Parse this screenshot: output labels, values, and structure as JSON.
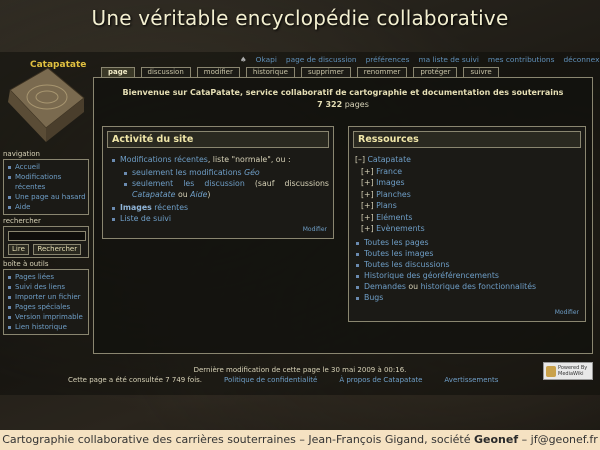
{
  "slide_title": "Une véritable encyclopédie collaborative",
  "site_name": "Catapatate",
  "user_links": [
    "Okapi",
    "page de discussion",
    "préférences",
    "ma liste de suivi",
    "mes contributions",
    "déconnexion"
  ],
  "tabs": [
    "page",
    "discussion",
    "modifier",
    "historique",
    "supprimer",
    "renommer",
    "protéger",
    "suivre"
  ],
  "welcome": "Bienvenue sur CataPatate, service collaboratif de cartographie et documentation des souterrains",
  "page_count": "7 322",
  "page_count_suffix": " pages",
  "activity": {
    "title": "Activité du site",
    "recent_changes": "Modifications récentes",
    "recent_suffix": ", liste \"normale\", ou :",
    "sub1_prefix": "seulement les modifications ",
    "sub1_link": "Géo",
    "sub2_prefix": "seulement les ",
    "sub2_link": "discussion",
    "sub2_suffix": " (sauf discussions ",
    "sub2_i1": "Catapatate",
    "sub2_ou": " ou ",
    "sub2_i2": "Aide",
    "sub2_end": ")",
    "images_bold": "Images",
    "images_rest": " récentes",
    "watchlist": "Liste de suivi",
    "modify": "Modifier"
  },
  "resources": {
    "title": "Ressources",
    "tree_root": "Catapatate",
    "tree_root_toggle": "[–]",
    "tree_children": [
      "France",
      "Images",
      "Planches",
      "Plans",
      "Eléments",
      "Evènements"
    ],
    "tree_toggle": "[+]",
    "links": [
      "Toutes les pages",
      "Toutes les images",
      "Toutes les discussions",
      "Historique des géoréférencements"
    ],
    "demandes": "Demandes",
    "ou": " ou ",
    "historique": "historique",
    "des_fonct": " des fonctionnalités",
    "bugs": "Bugs",
    "modify": "Modifier"
  },
  "sidebar": {
    "nav_title": "navigation",
    "nav_items": [
      "Accueil",
      "Modifications récentes",
      "Une page au hasard",
      "Aide"
    ],
    "search_title": "rechercher",
    "search_go": "Lire",
    "search_btn": "Rechercher",
    "tools_title": "boîte à outils",
    "tool_items": [
      "Pages liées",
      "Suivi des liens",
      "Importer un fichier",
      "Pages spéciales",
      "Version imprimable",
      "Lien historique"
    ]
  },
  "footer": {
    "lastmod": "Dernière modification de cette page le 30 mai 2009 à 00:16.",
    "views": "Cette page a été consultée 7 749 fois.",
    "privacy": "Politique de confidentialité",
    "about": "À propos de Catapatate",
    "disclaimer": "Avertissements",
    "mw_badge": "Powered By MediaWiki"
  },
  "bottom_bar": {
    "label": "Cartographie collaborative des carrières souterraines",
    "dash": " – Jean-François Gigand, société ",
    "company": "Geonef",
    "email": " – jf@geonef.fr"
  }
}
